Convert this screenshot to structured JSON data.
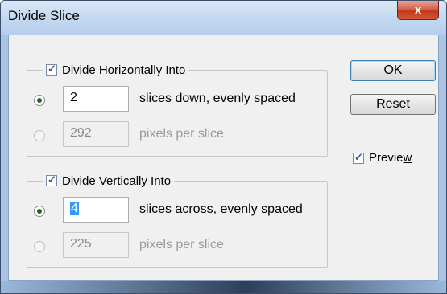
{
  "dialog": {
    "title": "Divide Slice",
    "close_label": "x"
  },
  "horizontal": {
    "legend": "Divide Horizontally Into",
    "checked": true,
    "slices_value": "2",
    "slices_label": "slices down, evenly spaced",
    "pixels_value": "292",
    "pixels_label": "pixels per slice"
  },
  "vertical": {
    "legend": "Divide Vertically Into",
    "checked": true,
    "slices_value": "4",
    "slices_label": "slices across, evenly spaced",
    "pixels_value": "225",
    "pixels_label": "pixels per slice"
  },
  "buttons": {
    "ok": "OK",
    "reset": "Reset"
  },
  "preview": {
    "label_prefix": "Previe",
    "label_underlined": "w",
    "checked": true
  }
}
